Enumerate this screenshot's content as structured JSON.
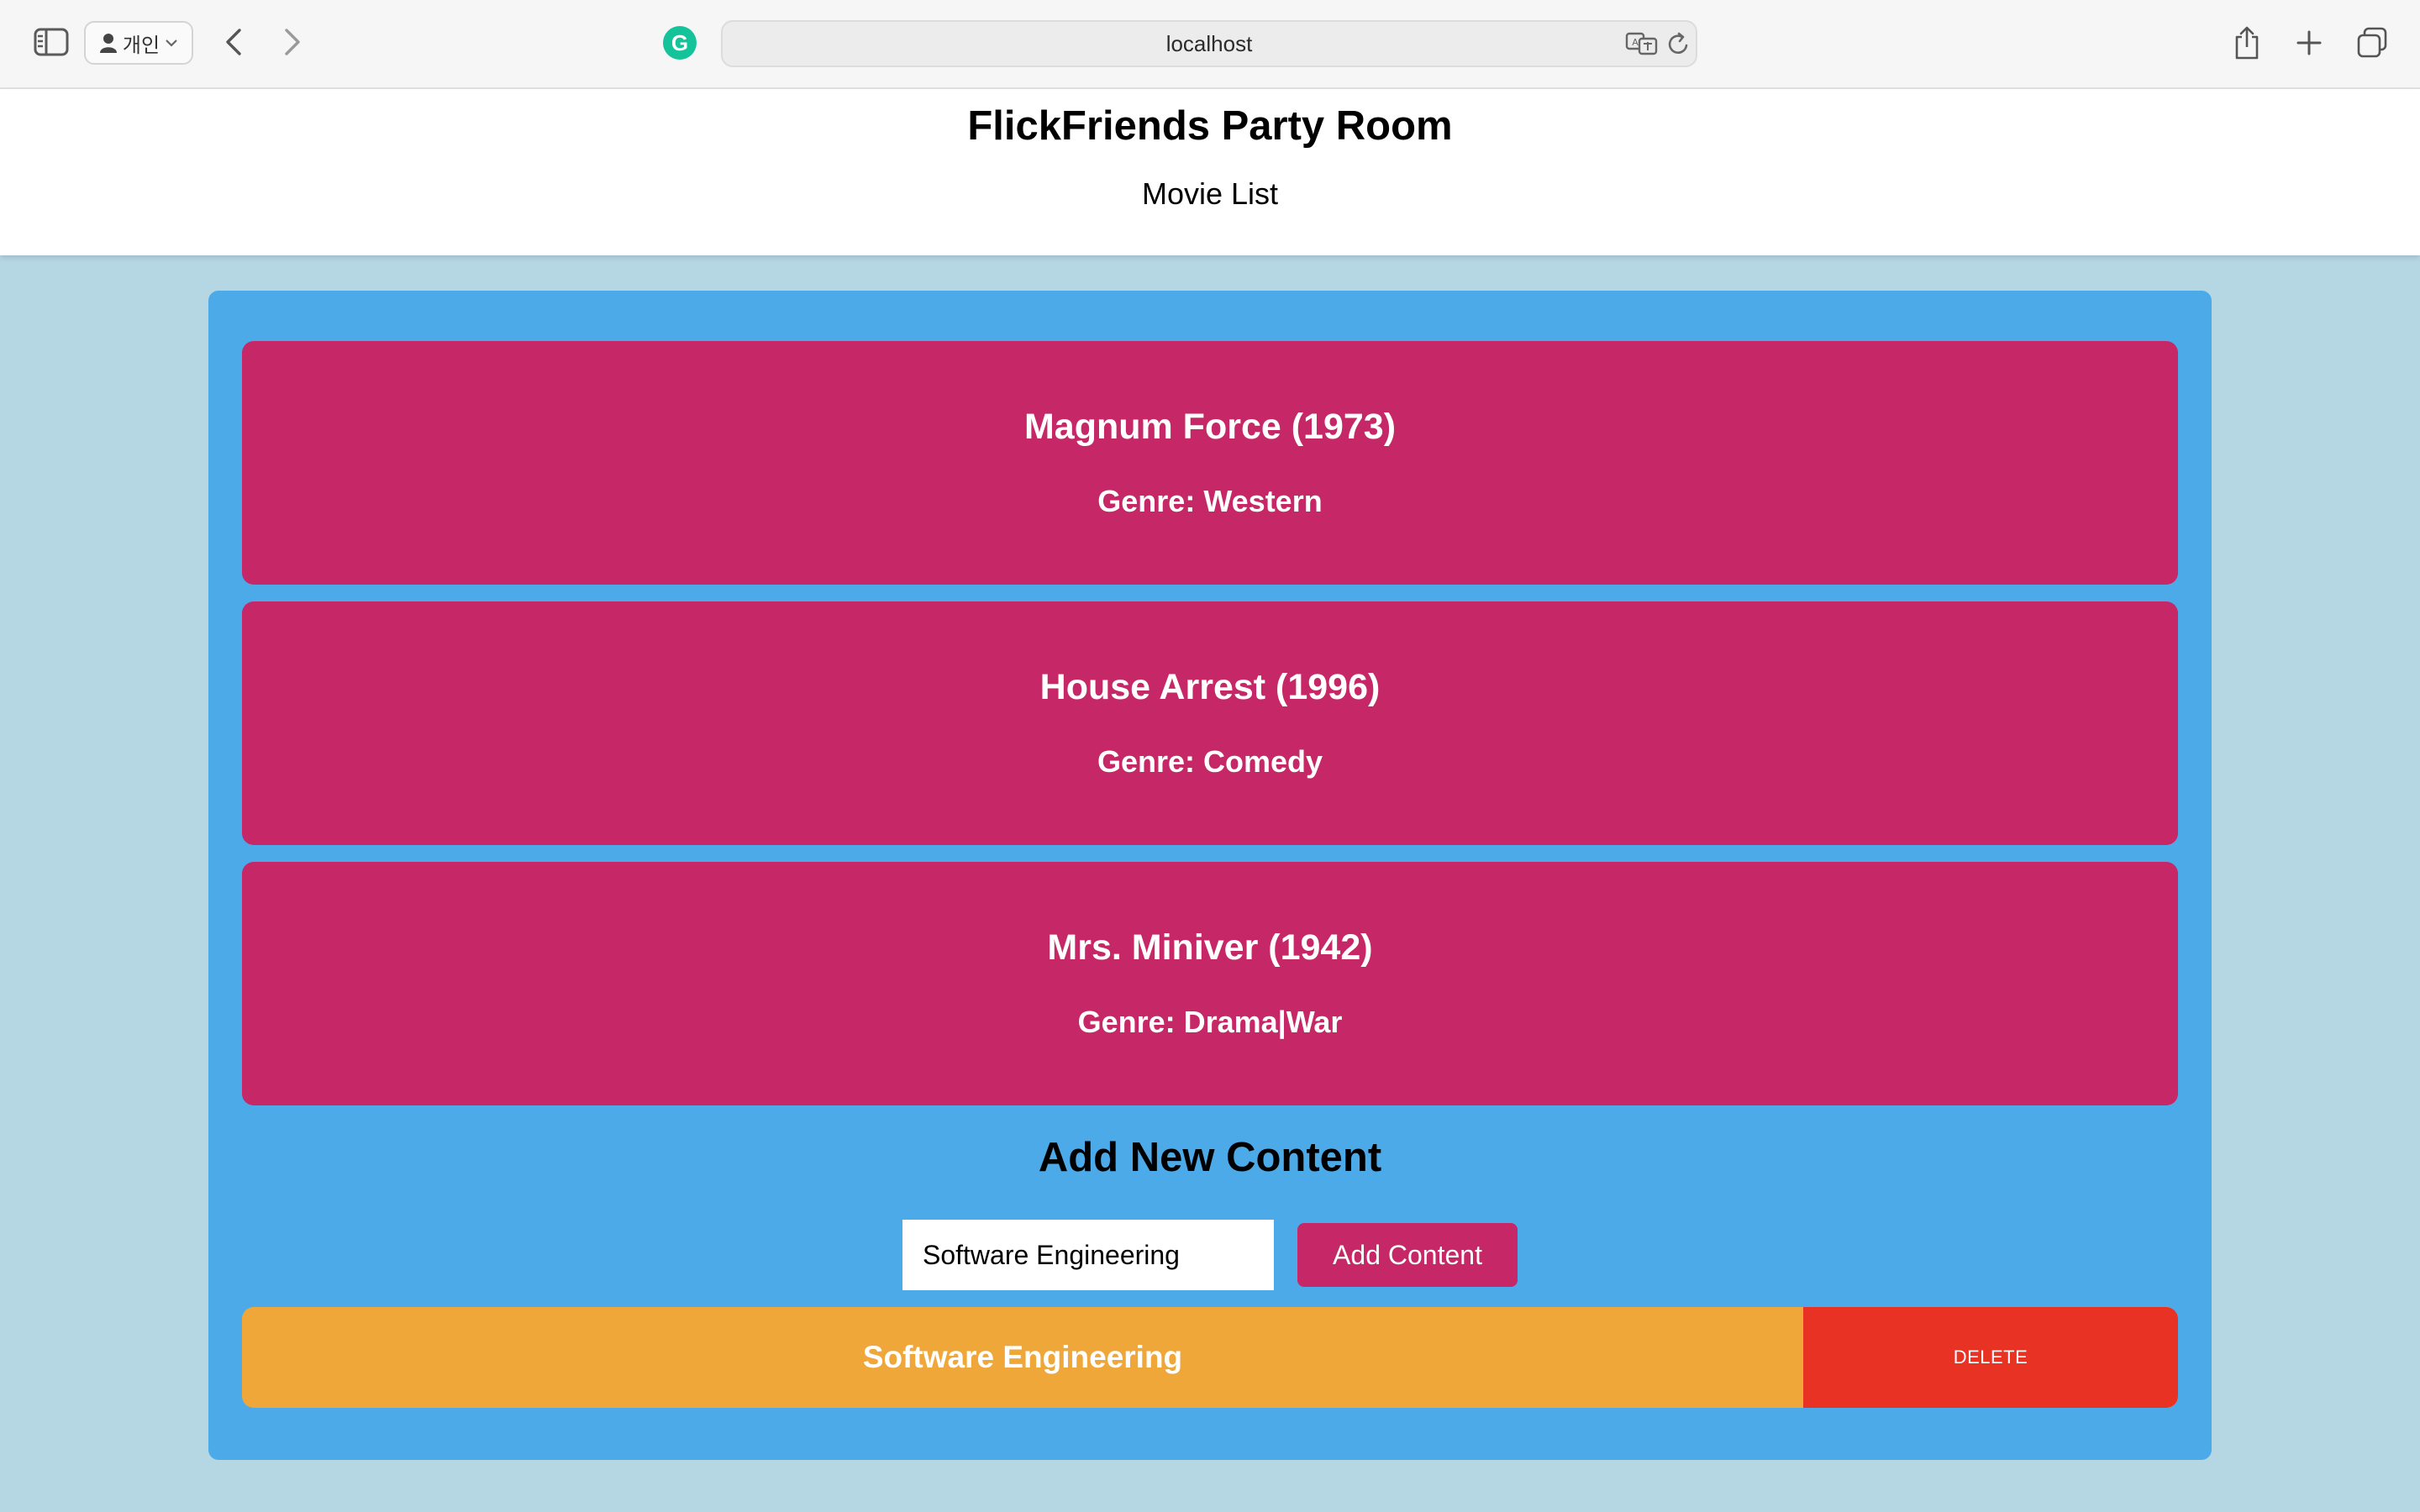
{
  "browser": {
    "profile_label": "개인",
    "url": "localhost",
    "grammarly_letter": "G"
  },
  "header": {
    "title": "FlickFriends Party Room",
    "subtitle": "Movie List"
  },
  "movies": [
    {
      "title": "Magnum Force (1973)",
      "genre": "Genre: Western"
    },
    {
      "title": "House Arrest (1996)",
      "genre": "Genre: Comedy"
    },
    {
      "title": "Mrs. Miniver (1942)",
      "genre": "Genre: Drama|War"
    }
  ],
  "add_content": {
    "heading": "Add New Content",
    "input_value": "Software Engineering",
    "button_label": "Add Content"
  },
  "content_items": [
    {
      "label": "Software Engineering",
      "delete_label": "DELETE"
    }
  ],
  "colors": {
    "page_background": "#b5d7e4",
    "panel": "#4daae9",
    "movie_card": "#c52767",
    "content_item": "#f0a73a",
    "delete": "#e83224"
  }
}
